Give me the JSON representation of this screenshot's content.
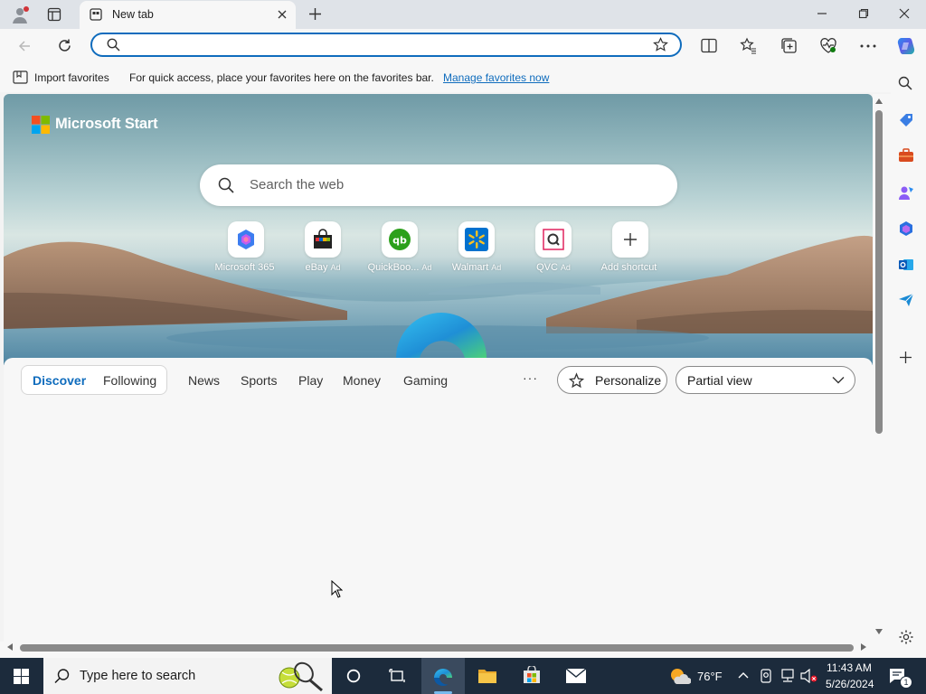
{
  "browser": {
    "tab_title": "New tab",
    "address_value": "",
    "address_placeholder": ""
  },
  "favorites_bar": {
    "import_label": "Import favorites",
    "message": "For quick access, place your favorites here on the favorites bar.",
    "manage_link": "Manage favorites now"
  },
  "newtab": {
    "brand": "Microsoft Start",
    "search_placeholder": "Search the web",
    "shortcuts": [
      {
        "label": "Microsoft 365",
        "ad": "",
        "icon": "microsoft-365-icon"
      },
      {
        "label": "eBay",
        "ad": "Ad",
        "icon": "ebay-icon"
      },
      {
        "label": "QuickBoo...",
        "ad": "Ad",
        "icon": "quickbooks-icon"
      },
      {
        "label": "Walmart",
        "ad": "Ad",
        "icon": "walmart-icon"
      },
      {
        "label": "QVC",
        "ad": "Ad",
        "icon": "qvc-icon"
      },
      {
        "label": "Add shortcut",
        "ad": "",
        "icon": "plus-icon"
      }
    ],
    "feed_tabs": [
      "Discover",
      "Following",
      "News",
      "Sports",
      "Play",
      "Money",
      "Gaming"
    ],
    "active_tab": "Discover",
    "more": "···",
    "personalize": "Personalize",
    "view_select": "Partial view"
  },
  "taskbar": {
    "search_placeholder": "Type here to search",
    "weather": "76°F",
    "time": "11:43 AM",
    "date": "5/26/2024",
    "notification_count": "1"
  },
  "colors": {
    "accent": "#0f6cbd",
    "taskbar": "#1c2b3c"
  }
}
